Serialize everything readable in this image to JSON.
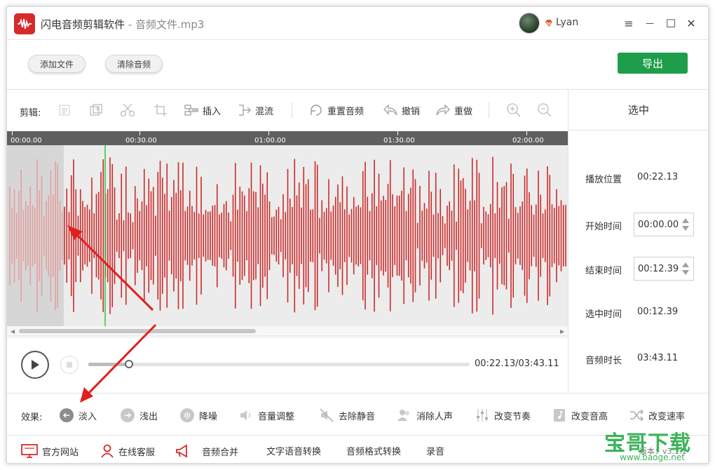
{
  "app": {
    "title": "闪电音频剪辑软件",
    "separator": " - ",
    "filename": "音频文件.mp3",
    "logo_icon": "waveform-icon",
    "username": "Lyan",
    "vip_icon": "vip-diamond-icon",
    "accent_color": "#d62b2b"
  },
  "window_controls": {
    "menu": "≡",
    "minimize": "—",
    "maximize": "☐",
    "close": "✕"
  },
  "actions": {
    "add_file": "添加文件",
    "clear_audio": "清除音频",
    "export": "导出",
    "export_color": "#1e9e4a"
  },
  "toolbar": {
    "label": "剪辑:",
    "insert": "插入",
    "mix": "混流",
    "reset": "重置音频",
    "undo": "撤销",
    "redo": "重做"
  },
  "timeline": {
    "ticks": [
      "00:00.00",
      "00:30.00",
      "01:00.00",
      "01:30.00",
      "02:00.00"
    ],
    "wave_color": "#cc2a2a"
  },
  "panel": {
    "header": "选中",
    "position_label": "播放位置",
    "position_value": "00:22.13",
    "start_label": "开始时间",
    "start_value": "00:00.00",
    "end_label": "结束时间",
    "end_value": "00:12.39",
    "selected_label": "选中时间",
    "selected_value": "00:12.39",
    "duration_label": "音频时长",
    "duration_value": "03:43.11"
  },
  "player": {
    "readout": "00:22.13/03:43.11",
    "progress_fraction": 0.107
  },
  "effects": {
    "label": "效果:",
    "fade_in": "淡入",
    "fade_out": "浅出",
    "denoise": "降噪",
    "volume": "音量调整",
    "remove_silence": "去除静音",
    "remove_vocal": "消除人声",
    "tempo": "改变节奏",
    "pitch": "改变音高",
    "speed": "改变速率"
  },
  "links": {
    "website": "官方网站",
    "service": "在线客服",
    "merge": "音频合并",
    "tts": "文字语音转换",
    "convert": "音频格式转换",
    "record": "录音",
    "version": "版本：v3.1.1"
  },
  "watermark": {
    "text": "宝哥下载",
    "url": "www.baoge.net"
  }
}
